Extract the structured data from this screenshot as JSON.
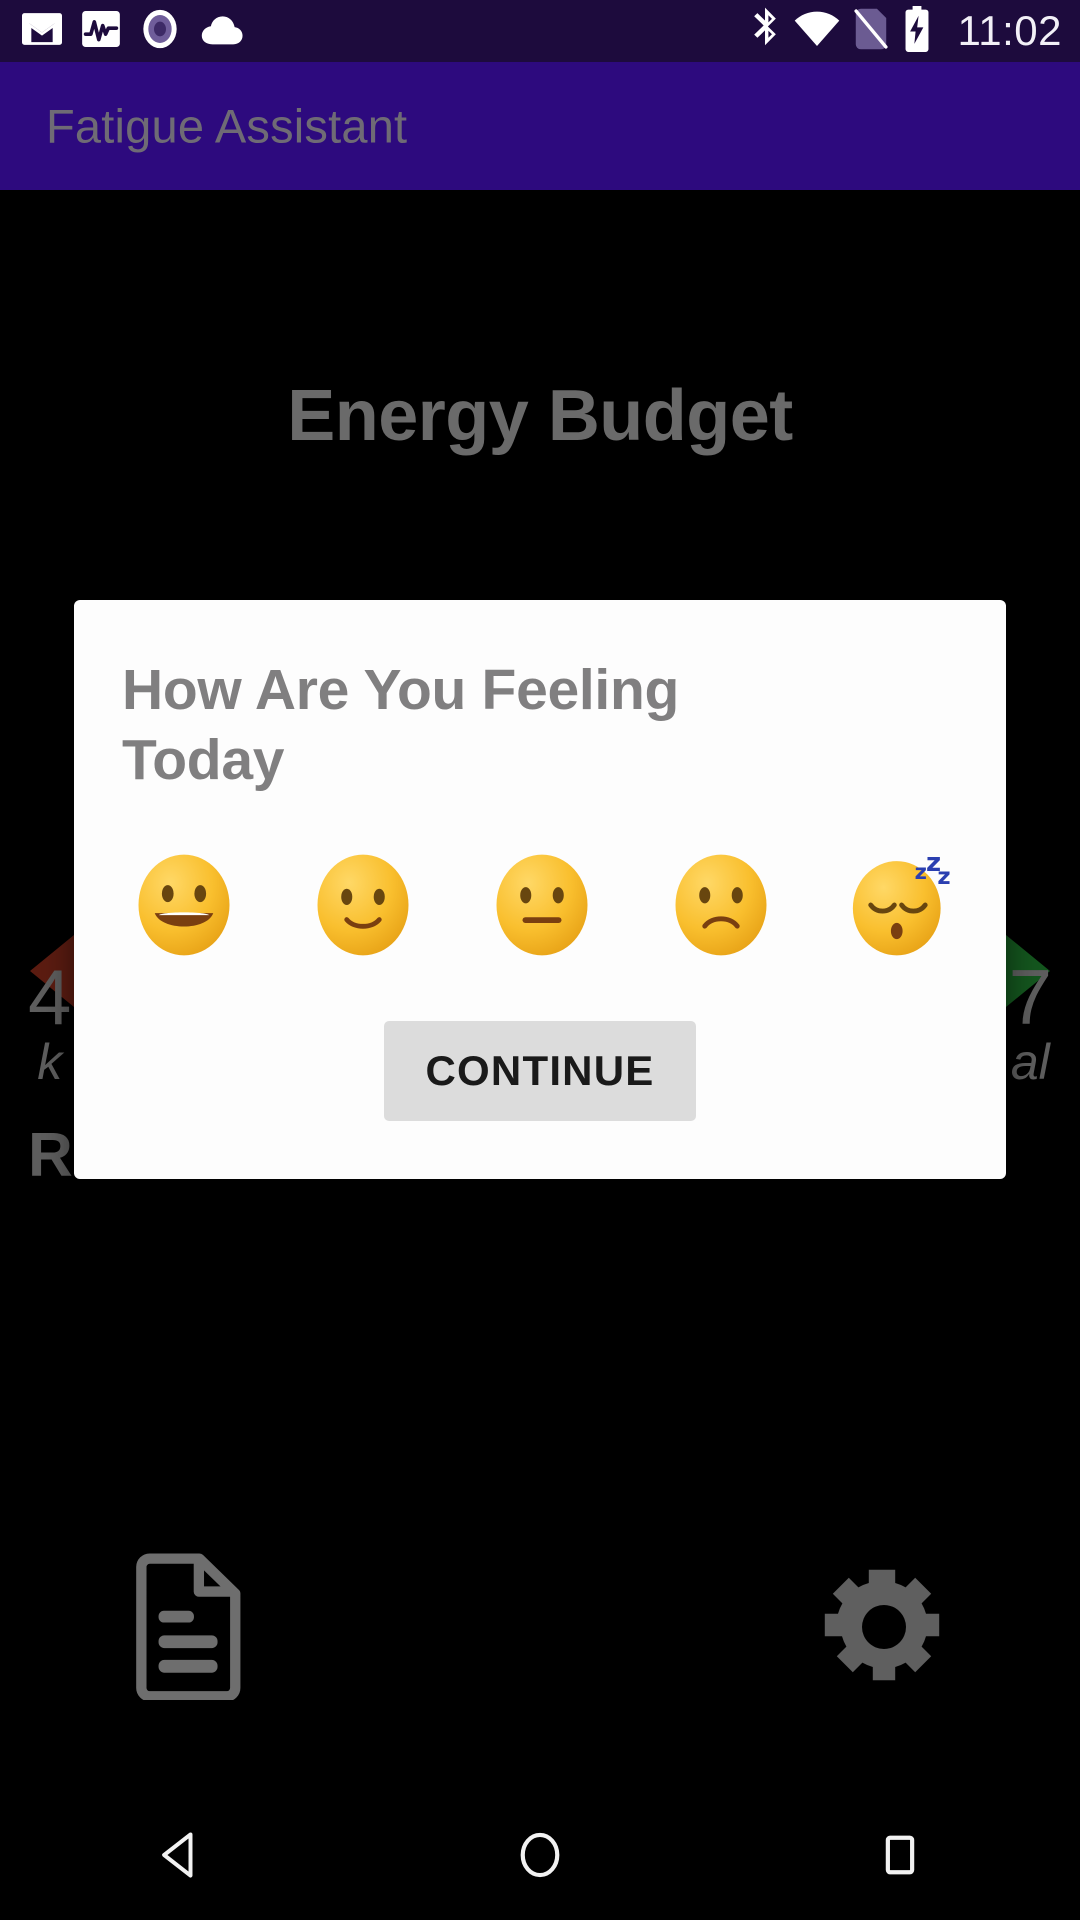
{
  "status_bar": {
    "background_color": "#1d0b3d",
    "time": "11:02",
    "left_icons": [
      {
        "name": "gmail-icon",
        "label": "Gmail"
      },
      {
        "name": "activity-chart-icon",
        "label": "Activity"
      },
      {
        "name": "record-dot-icon",
        "label": "Recording"
      },
      {
        "name": "cloud-icon",
        "label": "Cloud"
      }
    ],
    "right_icons": [
      {
        "name": "bluetooth-icon",
        "label": "Bluetooth"
      },
      {
        "name": "wifi-icon",
        "label": "Wi-Fi"
      },
      {
        "name": "no-sim-icon",
        "label": "No SIM"
      },
      {
        "name": "battery-charging-icon",
        "label": "Battery charging"
      }
    ]
  },
  "app_bar": {
    "title": "Fatigue Assistant",
    "background_color": "#2d0a7e",
    "title_color": "#6f6b75"
  },
  "content": {
    "page_title": "Energy Budget",
    "gauge": {
      "left_marker_color": "#5c1c11",
      "right_marker_color": "#14561e",
      "arc_colors": [
        "#7a3a10",
        "#6d6a12",
        "#2f5a15"
      ]
    },
    "stats": {
      "left_value": "4",
      "left_unit": "k",
      "right_value": "7",
      "right_unit": "al",
      "sub_label": "R"
    },
    "bottom_icons": [
      {
        "name": "document-icon",
        "label": "Notes"
      },
      {
        "name": "gear-icon",
        "label": "Settings"
      }
    ]
  },
  "dialog": {
    "title": "How Are You Feeling Today",
    "title_color": "#807f80",
    "background_color": "#fdfdfd",
    "moods": [
      {
        "name": "mood-grinning",
        "emoji": "😀",
        "label": "Grinning face"
      },
      {
        "name": "mood-slightly-smiling",
        "emoji": "🙂",
        "label": "Slightly smiling face"
      },
      {
        "name": "mood-neutral",
        "emoji": "😐",
        "label": "Neutral face"
      },
      {
        "name": "mood-frowning",
        "emoji": "😕",
        "label": "Confused face"
      },
      {
        "name": "mood-sleeping",
        "emoji": "😴",
        "label": "Sleeping face"
      }
    ],
    "continue_label": "CONTINUE",
    "continue_bg": "#dcdcdc"
  },
  "nav_bar": {
    "back_label": "Back",
    "home_label": "Home",
    "recents_label": "Recents"
  }
}
